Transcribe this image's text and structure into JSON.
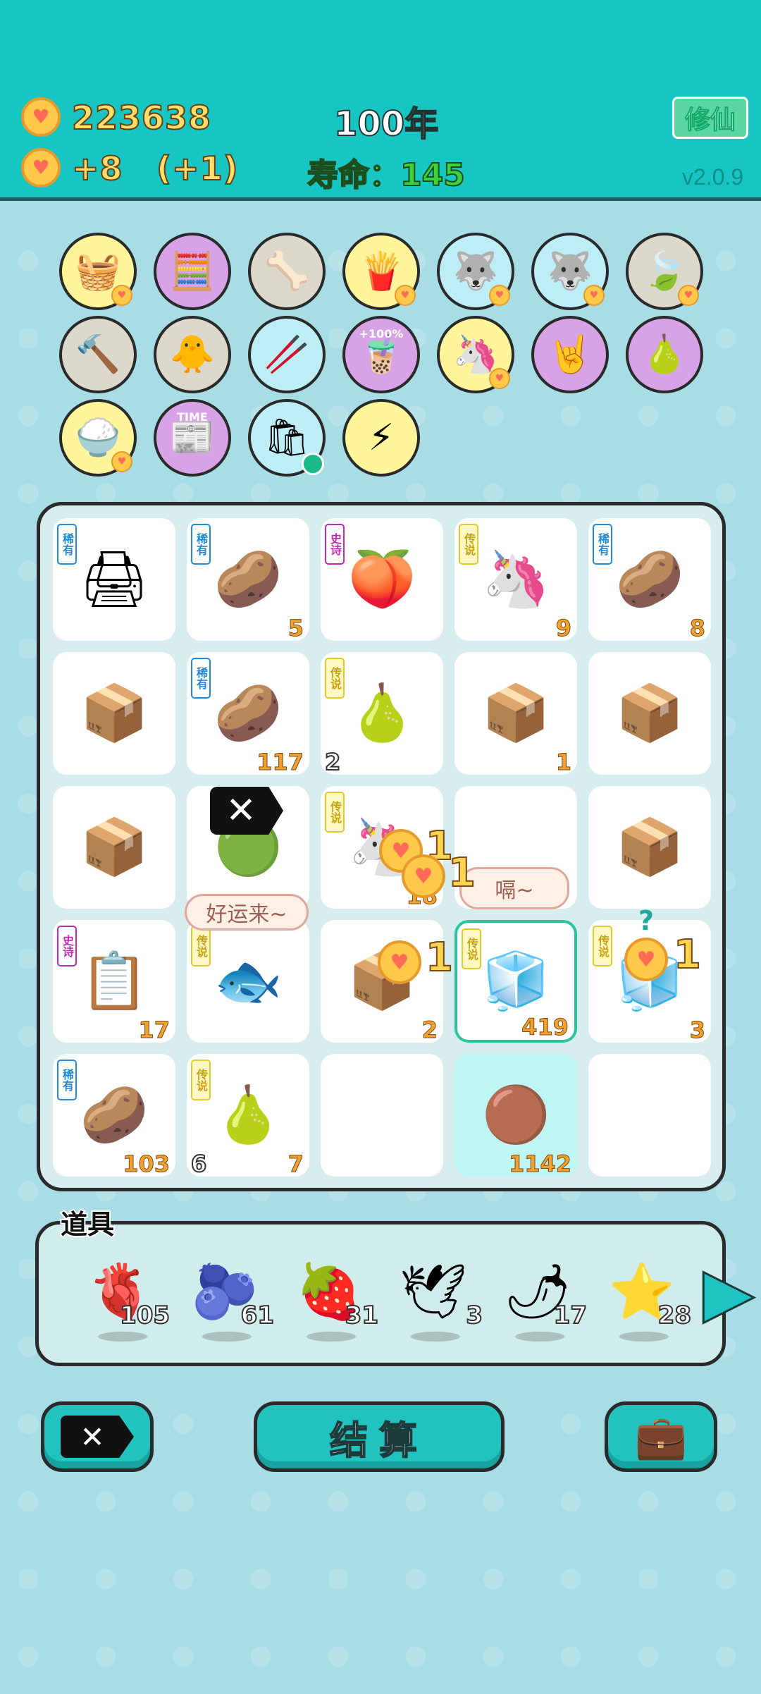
{
  "status": {
    "coins": "223638",
    "income": "+8",
    "bonus": "(+1)",
    "year": "100年",
    "lifespan": "寿命：145",
    "cultivate": "修仙",
    "version": "v2.0.9"
  },
  "badges": [
    {
      "icon": "basket-icon",
      "glyph": "🧺",
      "color": "yellow",
      "heart": true
    },
    {
      "icon": "math-kid-icon",
      "glyph": "🧮",
      "color": "purple",
      "heart": false
    },
    {
      "icon": "dog-bowl-icon",
      "glyph": "🦴",
      "color": "grey",
      "heart": false
    },
    {
      "icon": "fries-icon",
      "glyph": "🍟",
      "color": "yellow",
      "heart": true
    },
    {
      "icon": "husky-icon",
      "glyph": "🐺",
      "color": "cyan",
      "heart": true
    },
    {
      "icon": "husky-icon",
      "glyph": "🐺",
      "color": "cyan",
      "heart": true
    },
    {
      "icon": "leaf-icon",
      "glyph": "🍃",
      "color": "grey",
      "heart": true
    },
    {
      "icon": "hammer-icon",
      "glyph": "🔨",
      "color": "grey",
      "heart": false
    },
    {
      "icon": "chick-icon",
      "glyph": "🐥",
      "color": "grey",
      "heart": false
    },
    {
      "icon": "chopsticks-icon",
      "glyph": "🥢",
      "color": "cyan",
      "heart": false
    },
    {
      "icon": "bubble-tea-icon",
      "glyph": "🧋",
      "color": "purple",
      "label": "+100%",
      "heart": false
    },
    {
      "icon": "unicorn-icon",
      "glyph": "🦄",
      "color": "yellow",
      "heart": true
    },
    {
      "icon": "rock-hand-icon",
      "glyph": "🤘",
      "color": "purple",
      "heart": false
    },
    {
      "icon": "pomelo-icon",
      "glyph": "🍐",
      "color": "purple",
      "heart": false
    },
    {
      "icon": "rice-bowl-icon",
      "glyph": "🍚",
      "color": "yellow",
      "heart": true
    },
    {
      "icon": "time-magazine-icon",
      "glyph": "📰",
      "color": "purple",
      "label": "TIME",
      "heart": false
    },
    {
      "icon": "trash-bag-icon",
      "glyph": "🛍",
      "color": "cyan",
      "heart": false
    },
    {
      "icon": "lightning-icon",
      "glyph": "⚡",
      "color": "yellow",
      "heart": false
    }
  ],
  "grid": [
    {
      "icon": "printer-icon",
      "glyph": "🖨",
      "tag": "稀有",
      "tagtype": "rare",
      "count": "",
      "lcount": ""
    },
    {
      "icon": "kiwi-fruit-icon",
      "glyph": "🥔",
      "tag": "稀有",
      "tagtype": "rare",
      "count": "5",
      "lcount": ""
    },
    {
      "icon": "peach-icon",
      "glyph": "🍑",
      "tag": "史诗",
      "tagtype": "epic",
      "count": "",
      "lcount": ""
    },
    {
      "icon": "unicorn-icon",
      "glyph": "🦄",
      "tag": "传说",
      "tagtype": "leg",
      "count": "9",
      "lcount": ""
    },
    {
      "icon": "kiwi-fruit-icon",
      "glyph": "🥔",
      "tag": "稀有",
      "tagtype": "rare",
      "count": "8",
      "lcount": ""
    },
    {
      "icon": "box-icon",
      "glyph": "📦",
      "tag": "",
      "tagtype": "",
      "count": "",
      "lcount": ""
    },
    {
      "icon": "kiwi-fruit-icon",
      "glyph": "🥔",
      "tag": "稀有",
      "tagtype": "rare",
      "count": "117",
      "lcount": ""
    },
    {
      "icon": "pomelo-icon",
      "glyph": "🍐",
      "tag": "传说",
      "tagtype": "leg",
      "count": "",
      "lcount": "2"
    },
    {
      "icon": "box-icon",
      "glyph": "📦",
      "tag": "",
      "tagtype": "",
      "count": "1",
      "lcount": ""
    },
    {
      "icon": "box-icon",
      "glyph": "📦",
      "tag": "",
      "tagtype": "",
      "count": "",
      "lcount": ""
    },
    {
      "icon": "box-icon",
      "glyph": "📦",
      "tag": "",
      "tagtype": "",
      "count": "",
      "lcount": ""
    },
    {
      "icon": "slime-icon",
      "glyph": "🟢",
      "tag": "",
      "tagtype": "",
      "count": "",
      "lcount": ""
    },
    {
      "icon": "unicorn-icon",
      "glyph": "🦄",
      "tag": "传说",
      "tagtype": "leg",
      "count": "18",
      "lcount": ""
    },
    {
      "icon": "empty",
      "glyph": "",
      "tag": "",
      "tagtype": "",
      "count": "",
      "lcount": ""
    },
    {
      "icon": "box-icon",
      "glyph": "📦",
      "tag": "",
      "tagtype": "",
      "count": "",
      "lcount": ""
    },
    {
      "icon": "copy-paste-icon",
      "glyph": "📋",
      "tag": "史诗",
      "tagtype": "epic",
      "count": "17",
      "lcount": ""
    },
    {
      "icon": "koi-fish-icon",
      "glyph": "🐟",
      "tag": "传说",
      "tagtype": "leg",
      "count": "",
      "lcount": ""
    },
    {
      "icon": "box-icon",
      "glyph": "📦",
      "tag": "",
      "tagtype": "",
      "count": "2",
      "lcount": ""
    },
    {
      "icon": "fridge-icon",
      "glyph": "🧊",
      "tag": "传说",
      "tagtype": "leg",
      "count": "419",
      "lcount": ""
    },
    {
      "icon": "fridge-icon",
      "glyph": "🧊",
      "tag": "传说",
      "tagtype": "leg",
      "count": "3",
      "lcount": ""
    },
    {
      "icon": "kiwi-fruit-icon",
      "glyph": "🥔",
      "tag": "稀有",
      "tagtype": "rare",
      "count": "103",
      "lcount": ""
    },
    {
      "icon": "pomelo-icon",
      "glyph": "🍐",
      "tag": "传说",
      "tagtype": "leg",
      "count": "7",
      "lcount": "6"
    },
    {
      "icon": "empty",
      "glyph": "",
      "tag": "",
      "tagtype": "",
      "count": "",
      "lcount": ""
    },
    {
      "icon": "longan-icon",
      "glyph": "🟤",
      "tag": "",
      "tagtype": "",
      "count": "1142",
      "lcount": ""
    },
    {
      "icon": "empty",
      "glyph": "",
      "tag": "",
      "tagtype": "",
      "count": "",
      "lcount": ""
    }
  ],
  "bubbles": {
    "luck": "好运来~",
    "burp": "嗝~",
    "question": "?"
  },
  "popups": [
    "1",
    "1",
    "1",
    "1"
  ],
  "tools": {
    "title": "道具",
    "items": [
      {
        "icon": "liver-icon",
        "glyph": "🫀",
        "count": "105"
      },
      {
        "icon": "blueberry-icon",
        "glyph": "🫐",
        "count": "61"
      },
      {
        "icon": "bayberry-icon",
        "glyph": "🍓",
        "count": "31"
      },
      {
        "icon": "pigeon-icon",
        "glyph": "🕊",
        "count": "3"
      },
      {
        "icon": "chili-icon",
        "glyph": "🌶",
        "count": "17"
      },
      {
        "icon": "star-icon",
        "glyph": "⭐",
        "count": "28"
      }
    ]
  },
  "actions": {
    "settle": "结算"
  }
}
